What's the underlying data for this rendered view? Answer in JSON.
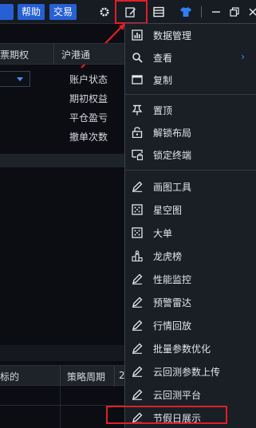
{
  "toolbar": {
    "help_label": "帮助",
    "trade_label": "交易",
    "icons": [
      "gear-icon",
      "edit-icon",
      "grid-icon",
      "shirt-icon",
      "minimize-icon",
      "restore-icon",
      "close-icon"
    ]
  },
  "table_top": {
    "col1": "票期权",
    "col2": "沪港通"
  },
  "account_panel": {
    "items": [
      "账户状态",
      "期初权益",
      "平仓盈亏",
      "撤单次数"
    ]
  },
  "table_bottom": {
    "col1": "标的",
    "col2": "策略周期",
    "col3": "2"
  },
  "menu": {
    "items": [
      {
        "label": "数据管理",
        "icon": "bar-chart-icon"
      },
      {
        "label": "查看",
        "icon": "search-icon",
        "has_submenu": true
      },
      {
        "label": "复制",
        "icon": "window-icon"
      },
      {
        "label": "置顶",
        "icon": "pin-icon"
      },
      {
        "label": "解锁布局",
        "icon": "unlock-icon"
      },
      {
        "label": "锁定终端",
        "icon": "lock-screen-icon"
      },
      {
        "label": "画图工具",
        "icon": "pencil-icon"
      },
      {
        "label": "星空图",
        "icon": "starmap-icon"
      },
      {
        "label": "大单",
        "icon": "starmap-icon"
      },
      {
        "label": "龙虎榜",
        "icon": "dragon-tiger-icon"
      },
      {
        "label": "性能监控",
        "icon": "pencil-icon"
      },
      {
        "label": "预警雷达",
        "icon": "pencil-icon"
      },
      {
        "label": "行情回放",
        "icon": "pencil-icon"
      },
      {
        "label": "批量参数优化",
        "icon": "pencil-icon"
      },
      {
        "label": "云回测参数上传",
        "icon": "pencil-icon"
      },
      {
        "label": "云回测平台",
        "icon": "pencil-icon"
      },
      {
        "label": "节假日展示",
        "icon": "pencil-icon"
      }
    ],
    "submenu_arrow": "›"
  },
  "colors": {
    "accent_blue": "#2760d4",
    "highlight_red": "#e21f26",
    "background": "#0b0d12",
    "menu_bg": "#1a1e25"
  }
}
